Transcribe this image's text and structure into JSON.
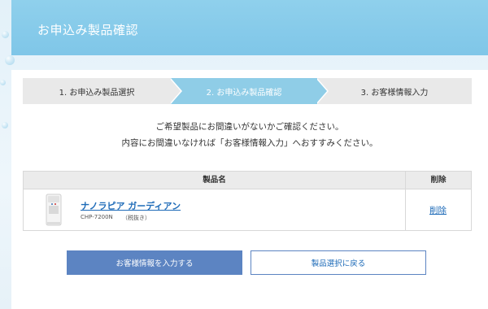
{
  "header": {
    "title": "お申込み製品確認"
  },
  "steps": [
    {
      "label": "1. お申込み製品選択"
    },
    {
      "label": "2. お申込み製品確認"
    },
    {
      "label": "3. お客様情報入力"
    }
  ],
  "active_step": 2,
  "message": {
    "line1": "ご希望製品にお間違いがないかご確認ください。",
    "line2": "内容にお間違いなければ「お客様情報入力」へおすすみください。"
  },
  "table": {
    "headers": {
      "name": "製品名",
      "delete": "削除"
    },
    "rows": [
      {
        "name": "ナノラピア ガーディアン",
        "code": "CHP-7200N",
        "tax": "（税抜き）",
        "delete": "削除"
      }
    ]
  },
  "buttons": {
    "primary": "お客様情報を入力する",
    "secondary": "製品選択に戻る"
  },
  "colors": {
    "header_bg": "#7fc6e8",
    "active_step": "#8fcde7",
    "primary_button": "#5c84c2",
    "link": "#1e6bb8"
  }
}
